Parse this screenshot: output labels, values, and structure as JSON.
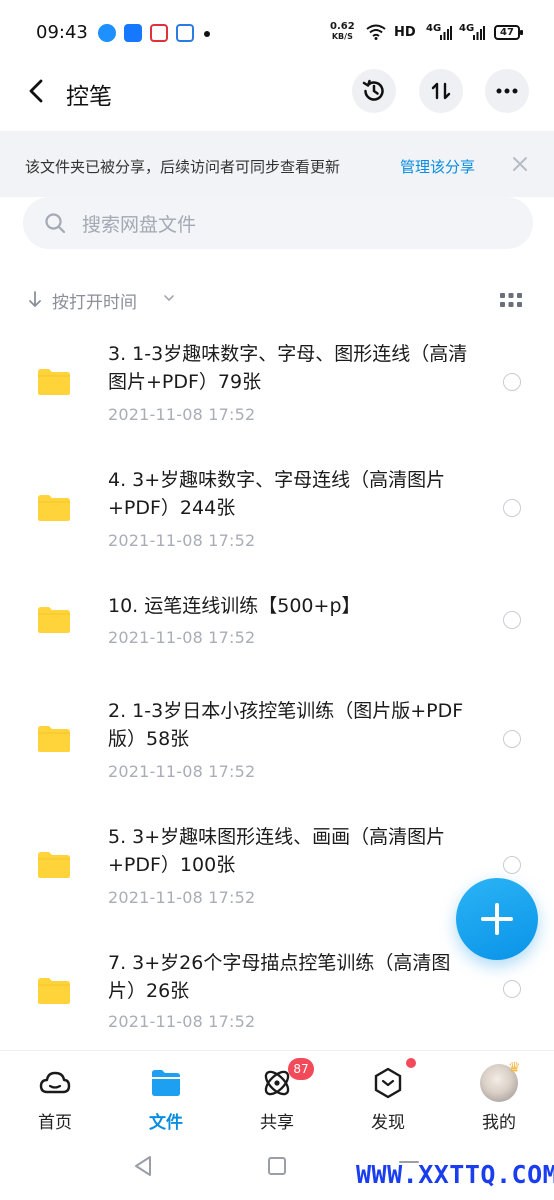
{
  "status_bar": {
    "time": "09:43",
    "net_speed_value": "0.62",
    "net_speed_unit": "KB/S",
    "hd": "HD",
    "signal_1": "4G",
    "signal_2": "4G",
    "battery": "47"
  },
  "header": {
    "title": "控笔",
    "back_icon": "chevron-left-icon",
    "history_icon": "history-icon",
    "sort_icon": "sort-updown-icon",
    "more_icon": "more-icon"
  },
  "banner": {
    "text": "该文件夹已被分享，后续访问者可同步查看更新",
    "link": "管理该分享"
  },
  "search": {
    "placeholder": "搜索网盘文件"
  },
  "sort": {
    "label": "按打开时间"
  },
  "files": [
    {
      "name": "3.  1-3岁趣味数字、字母、图形连线（高清图片+PDF）79张",
      "date": "2021-11-08  17:52"
    },
    {
      "name": "4.   3+岁趣味数字、字母连线（高清图片+PDF）244张",
      "date": "2021-11-08  17:52"
    },
    {
      "name": "10.  运笔连线训练【500+p】",
      "date": "2021-11-08  17:52"
    },
    {
      "name": "2.  1-3岁日本小孩控笔训练（图片版+PDF版）58张",
      "date": "2021-11-08  17:52"
    },
    {
      "name": "5.   3+岁趣味图形连线、画画（高清图片+PDF）100张",
      "date": "2021-11-08  17:52"
    },
    {
      "name": "7.  3+岁26个字母描点控笔训练（高清图片）26张",
      "date": "2021-11-08  17:52"
    }
  ],
  "nav": {
    "home": "首页",
    "files": "文件",
    "share": "共享",
    "discover": "发现",
    "mine": "我的",
    "share_badge": "87"
  },
  "colors": {
    "accent": "#0a8de0",
    "folder": "#ffd43b",
    "badge": "#f34a5a"
  },
  "watermark": "WWW.XXTTQ.COM"
}
